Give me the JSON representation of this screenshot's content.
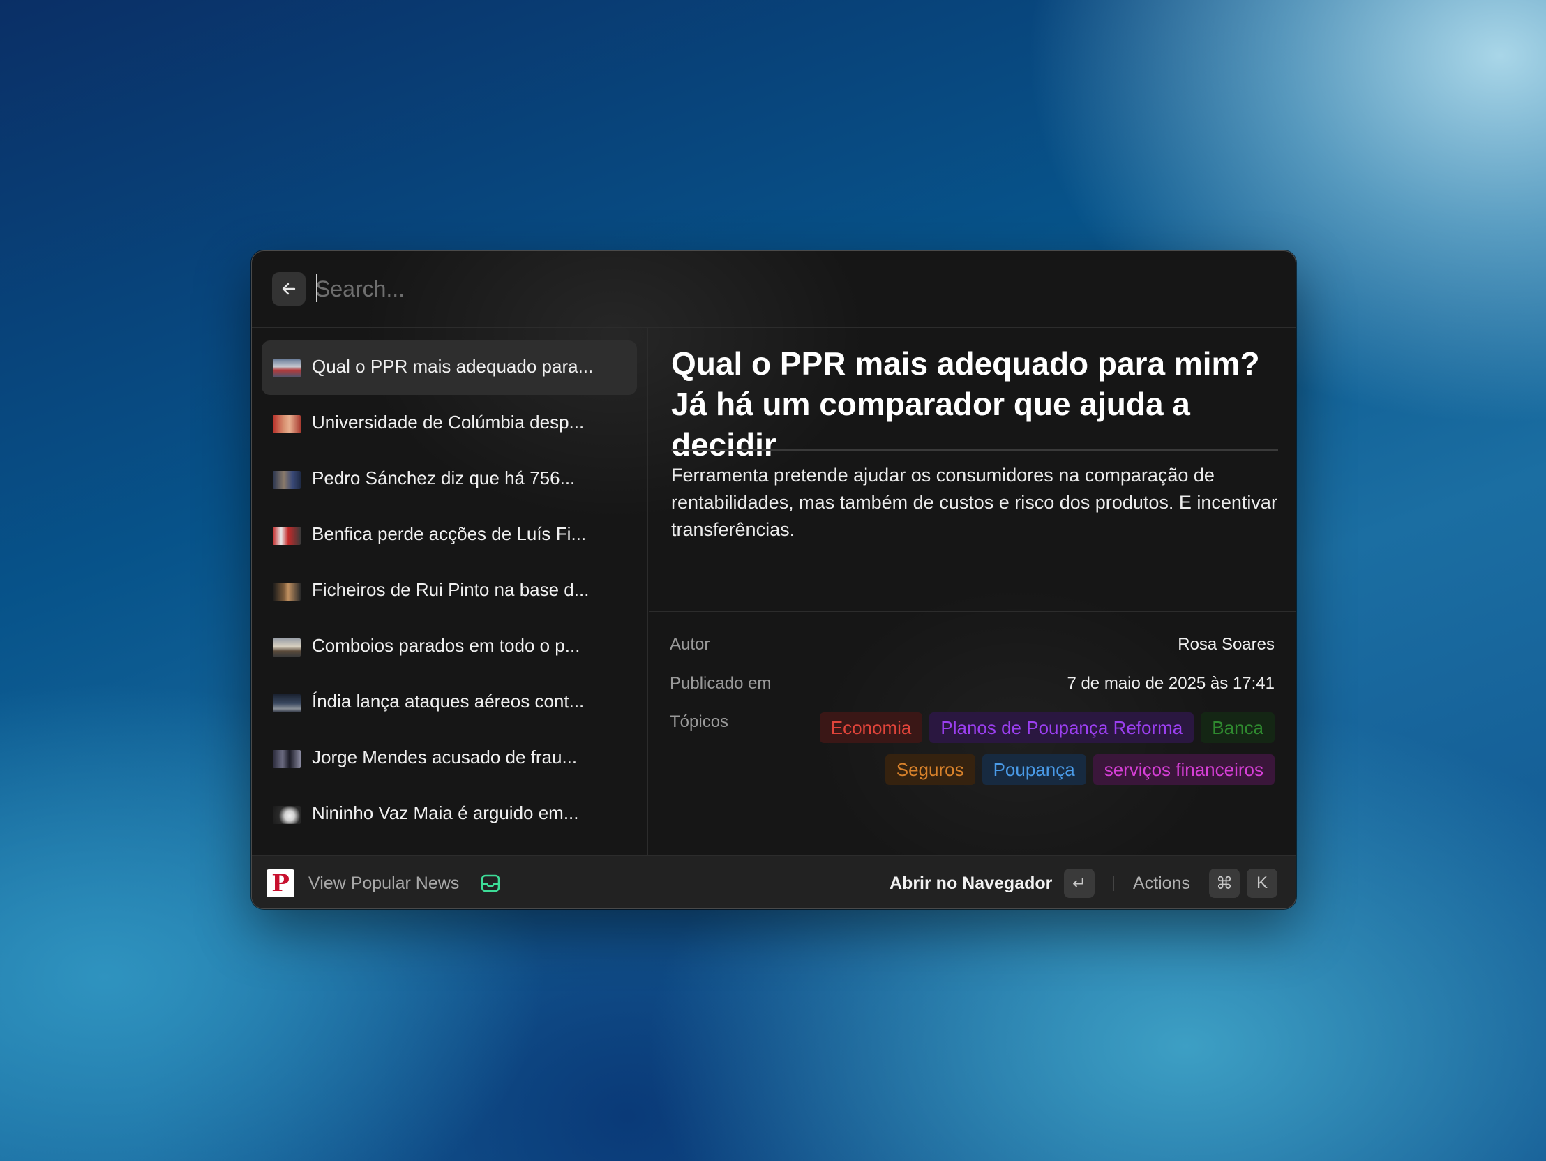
{
  "search": {
    "placeholder": "Search..."
  },
  "items": [
    {
      "label": "Qual o PPR mais adequado para...",
      "selected": true
    },
    {
      "label": "Universidade de Colúmbia desp..."
    },
    {
      "label": "Pedro Sánchez diz que há 756..."
    },
    {
      "label": "Benfica perde acções de Luís Fi..."
    },
    {
      "label": "Ficheiros de Rui Pinto na base d..."
    },
    {
      "label": "Comboios parados em todo o p..."
    },
    {
      "label": "Índia lança ataques aéreos cont..."
    },
    {
      "label": "Jorge Mendes acusado de frau..."
    },
    {
      "label": "Nininho Vaz Maia é arguido em..."
    }
  ],
  "detail": {
    "title": "Qual o PPR mais adequado para mim? Já há um comparador que ajuda a decidir",
    "summary": "Ferramenta pretende ajudar os consumidores na comparação de rentabilidades, mas também de custos e risco dos produtos. E incentivar transferências.",
    "meta": {
      "author_label": "Autor",
      "author": "Rosa Soares",
      "published_label": "Publicado em",
      "published": "7 de maio de 2025 às 17:41",
      "topics_label": "Tópicos"
    },
    "topics": [
      {
        "label": "Economia",
        "color": "#e0443a",
        "bg": "#3a1716"
      },
      {
        "label": "Planos de Poupança Reforma",
        "color": "#9b3ff0",
        "bg": "#2a1740"
      },
      {
        "label": "Banca",
        "color": "#2f8a2f",
        "bg": "#142614"
      },
      {
        "label": "Seguros",
        "color": "#d9822b",
        "bg": "#35220f"
      },
      {
        "label": "Poupança",
        "color": "#4a9be8",
        "bg": "#172a40"
      },
      {
        "label": "serviços financeiros",
        "color": "#d63fd6",
        "bg": "#3a163a"
      }
    ]
  },
  "footer": {
    "logo_letter": "P",
    "title": "View Popular News",
    "open_label": "Abrir no Navegador",
    "enter_key": "↵",
    "actions_label": "Actions",
    "cmd_key": "⌘",
    "k_key": "K"
  }
}
